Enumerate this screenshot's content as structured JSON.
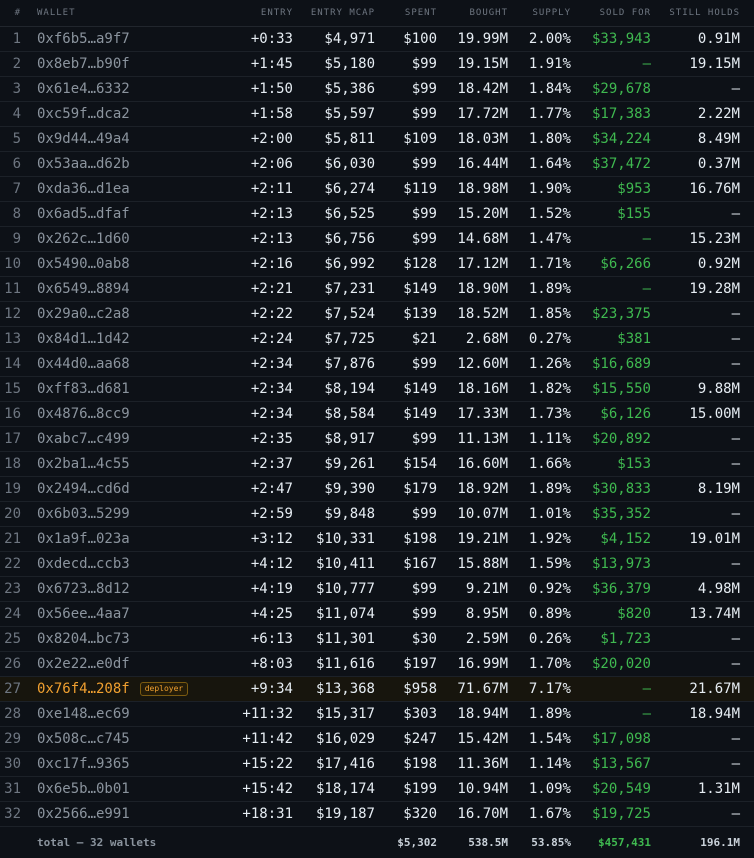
{
  "headers": {
    "idx": "#",
    "wallet": "WALLET",
    "entry": "ENTRY",
    "mcap": "ENTRY MCAP",
    "spent": "SPENT",
    "bought": "BOUGHT",
    "supply": "SUPPLY",
    "sold": "SOLD FOR",
    "holds": "STILL HOLDS"
  },
  "rows": [
    {
      "n": "1",
      "wallet": "0xf6b5…a9f7",
      "entry": "+0:33",
      "mcap": "$4,971",
      "spent": "$100",
      "bought": "19.99M",
      "supply": "2.00%",
      "sold": "$33,943",
      "holds": "0.91M"
    },
    {
      "n": "2",
      "wallet": "0x8eb7…b90f",
      "entry": "+1:45",
      "mcap": "$5,180",
      "spent": "$99",
      "bought": "19.15M",
      "supply": "1.91%",
      "sold": "—",
      "holds": "19.15M"
    },
    {
      "n": "3",
      "wallet": "0x61e4…6332",
      "entry": "+1:50",
      "mcap": "$5,386",
      "spent": "$99",
      "bought": "18.42M",
      "supply": "1.84%",
      "sold": "$29,678",
      "holds": "—"
    },
    {
      "n": "4",
      "wallet": "0xc59f…dca2",
      "entry": "+1:58",
      "mcap": "$5,597",
      "spent": "$99",
      "bought": "17.72M",
      "supply": "1.77%",
      "sold": "$17,383",
      "holds": "2.22M"
    },
    {
      "n": "5",
      "wallet": "0x9d44…49a4",
      "entry": "+2:00",
      "mcap": "$5,811",
      "spent": "$109",
      "bought": "18.03M",
      "supply": "1.80%",
      "sold": "$34,224",
      "holds": "8.49M"
    },
    {
      "n": "6",
      "wallet": "0x53aa…d62b",
      "entry": "+2:06",
      "mcap": "$6,030",
      "spent": "$99",
      "bought": "16.44M",
      "supply": "1.64%",
      "sold": "$37,472",
      "holds": "0.37M"
    },
    {
      "n": "7",
      "wallet": "0xda36…d1ea",
      "entry": "+2:11",
      "mcap": "$6,274",
      "spent": "$119",
      "bought": "18.98M",
      "supply": "1.90%",
      "sold": "$953",
      "holds": "16.76M"
    },
    {
      "n": "8",
      "wallet": "0x6ad5…dfaf",
      "entry": "+2:13",
      "mcap": "$6,525",
      "spent": "$99",
      "bought": "15.20M",
      "supply": "1.52%",
      "sold": "$155",
      "holds": "—"
    },
    {
      "n": "9",
      "wallet": "0x262c…1d60",
      "entry": "+2:13",
      "mcap": "$6,756",
      "spent": "$99",
      "bought": "14.68M",
      "supply": "1.47%",
      "sold": "—",
      "holds": "15.23M"
    },
    {
      "n": "10",
      "wallet": "0x5490…0ab8",
      "entry": "+2:16",
      "mcap": "$6,992",
      "spent": "$128",
      "bought": "17.12M",
      "supply": "1.71%",
      "sold": "$6,266",
      "holds": "0.92M"
    },
    {
      "n": "11",
      "wallet": "0x6549…8894",
      "entry": "+2:21",
      "mcap": "$7,231",
      "spent": "$149",
      "bought": "18.90M",
      "supply": "1.89%",
      "sold": "—",
      "holds": "19.28M"
    },
    {
      "n": "12",
      "wallet": "0x29a0…c2a8",
      "entry": "+2:22",
      "mcap": "$7,524",
      "spent": "$139",
      "bought": "18.52M",
      "supply": "1.85%",
      "sold": "$23,375",
      "holds": "—"
    },
    {
      "n": "13",
      "wallet": "0x84d1…1d42",
      "entry": "+2:24",
      "mcap": "$7,725",
      "spent": "$21",
      "bought": "2.68M",
      "supply": "0.27%",
      "sold": "$381",
      "holds": "—"
    },
    {
      "n": "14",
      "wallet": "0x44d0…aa68",
      "entry": "+2:34",
      "mcap": "$7,876",
      "spent": "$99",
      "bought": "12.60M",
      "supply": "1.26%",
      "sold": "$16,689",
      "holds": "—"
    },
    {
      "n": "15",
      "wallet": "0xff83…d681",
      "entry": "+2:34",
      "mcap": "$8,194",
      "spent": "$149",
      "bought": "18.16M",
      "supply": "1.82%",
      "sold": "$15,550",
      "holds": "9.88M"
    },
    {
      "n": "16",
      "wallet": "0x4876…8cc9",
      "entry": "+2:34",
      "mcap": "$8,584",
      "spent": "$149",
      "bought": "17.33M",
      "supply": "1.73%",
      "sold": "$6,126",
      "holds": "15.00M"
    },
    {
      "n": "17",
      "wallet": "0xabc7…c499",
      "entry": "+2:35",
      "mcap": "$8,917",
      "spent": "$99",
      "bought": "11.13M",
      "supply": "1.11%",
      "sold": "$20,892",
      "holds": "—"
    },
    {
      "n": "18",
      "wallet": "0x2ba1…4c55",
      "entry": "+2:37",
      "mcap": "$9,261",
      "spent": "$154",
      "bought": "16.60M",
      "supply": "1.66%",
      "sold": "$153",
      "holds": "—"
    },
    {
      "n": "19",
      "wallet": "0x2494…cd6d",
      "entry": "+2:47",
      "mcap": "$9,390",
      "spent": "$179",
      "bought": "18.92M",
      "supply": "1.89%",
      "sold": "$30,833",
      "holds": "8.19M"
    },
    {
      "n": "20",
      "wallet": "0x6b03…5299",
      "entry": "+2:59",
      "mcap": "$9,848",
      "spent": "$99",
      "bought": "10.07M",
      "supply": "1.01%",
      "sold": "$35,352",
      "holds": "—"
    },
    {
      "n": "21",
      "wallet": "0x1a9f…023a",
      "entry": "+3:12",
      "mcap": "$10,331",
      "spent": "$198",
      "bought": "19.21M",
      "supply": "1.92%",
      "sold": "$4,152",
      "holds": "19.01M"
    },
    {
      "n": "22",
      "wallet": "0xdecd…ccb3",
      "entry": "+4:12",
      "mcap": "$10,411",
      "spent": "$167",
      "bought": "15.88M",
      "supply": "1.59%",
      "sold": "$13,973",
      "holds": "—"
    },
    {
      "n": "23",
      "wallet": "0x6723…8d12",
      "entry": "+4:19",
      "mcap": "$10,777",
      "spent": "$99",
      "bought": "9.21M",
      "supply": "0.92%",
      "sold": "$36,379",
      "holds": "4.98M"
    },
    {
      "n": "24",
      "wallet": "0x56ee…4aa7",
      "entry": "+4:25",
      "mcap": "$11,074",
      "spent": "$99",
      "bought": "8.95M",
      "supply": "0.89%",
      "sold": "$820",
      "holds": "13.74M"
    },
    {
      "n": "25",
      "wallet": "0x8204…bc73",
      "entry": "+6:13",
      "mcap": "$11,301",
      "spent": "$30",
      "bought": "2.59M",
      "supply": "0.26%",
      "sold": "$1,723",
      "holds": "—"
    },
    {
      "n": "26",
      "wallet": "0x2e22…e0df",
      "entry": "+8:03",
      "mcap": "$11,616",
      "spent": "$197",
      "bought": "16.99M",
      "supply": "1.70%",
      "sold": "$20,020",
      "holds": "—"
    },
    {
      "n": "27",
      "wallet": "0x76f4…208f",
      "entry": "+9:34",
      "mcap": "$13,368",
      "spent": "$958",
      "bought": "71.67M",
      "supply": "7.17%",
      "sold": "—",
      "holds": "21.67M",
      "badge": "deployer"
    },
    {
      "n": "28",
      "wallet": "0xe148…ec69",
      "entry": "+11:32",
      "mcap": "$15,317",
      "spent": "$303",
      "bought": "18.94M",
      "supply": "1.89%",
      "sold": "—",
      "holds": "18.94M"
    },
    {
      "n": "29",
      "wallet": "0x508c…c745",
      "entry": "+11:42",
      "mcap": "$16,029",
      "spent": "$247",
      "bought": "15.42M",
      "supply": "1.54%",
      "sold": "$17,098",
      "holds": "—"
    },
    {
      "n": "30",
      "wallet": "0xc17f…9365",
      "entry": "+15:22",
      "mcap": "$17,416",
      "spent": "$198",
      "bought": "11.36M",
      "supply": "1.14%",
      "sold": "$13,567",
      "holds": "—"
    },
    {
      "n": "31",
      "wallet": "0x6e5b…0b01",
      "entry": "+15:42",
      "mcap": "$18,174",
      "spent": "$199",
      "bought": "10.94M",
      "supply": "1.09%",
      "sold": "$20,549",
      "holds": "1.31M"
    },
    {
      "n": "32",
      "wallet": "0x2566…e991",
      "entry": "+18:31",
      "mcap": "$19,187",
      "spent": "$320",
      "bought": "16.70M",
      "supply": "1.67%",
      "sold": "$19,725",
      "holds": "—"
    }
  ],
  "total": {
    "label": "total — 32 wallets",
    "spent": "$5,302",
    "bought": "538.5M",
    "supply": "53.85%",
    "sold": "$457,431",
    "holds": "196.1M"
  }
}
